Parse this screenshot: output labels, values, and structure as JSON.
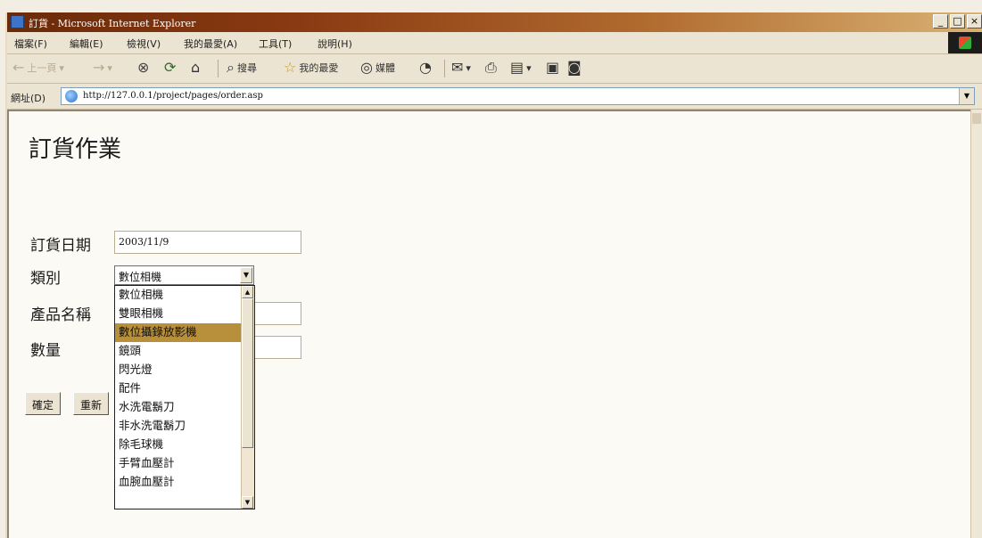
{
  "window": {
    "title": "訂貨 - Microsoft Internet Explorer",
    "controls": {
      "minimize": "_",
      "maximize": "□",
      "close": "×"
    }
  },
  "menu": {
    "items": [
      "檔案(F)",
      "編輯(E)",
      "檢視(V)",
      "我的最愛(A)",
      "工具(T)",
      "說明(H)"
    ]
  },
  "toolbar": {
    "back": "上一頁",
    "search": "搜尋",
    "favorites": "我的最愛",
    "media": "媒體"
  },
  "address": {
    "label": "網址(D)",
    "url": "http://127.0.0.1/project/pages/order.asp"
  },
  "page": {
    "title": "訂貨作業",
    "order_date": {
      "label": "訂貨日期",
      "value": "2003/11/9"
    },
    "category": {
      "label": "類別",
      "selected": "數位相機",
      "options": [
        "數位相機",
        "雙眼相機",
        "數位攝錄放影機",
        "鏡頭",
        "閃光燈",
        "配件",
        "水洗電鬍刀",
        "非水洗電鬍刀",
        "除毛球機",
        "手臂血壓計",
        "血腕血壓計"
      ],
      "highlighted_index": 2
    },
    "product_name": {
      "label": "產品名稱"
    },
    "quantity": {
      "label": "數量"
    },
    "buttons": {
      "confirm": "確定",
      "reset": "重新"
    }
  }
}
